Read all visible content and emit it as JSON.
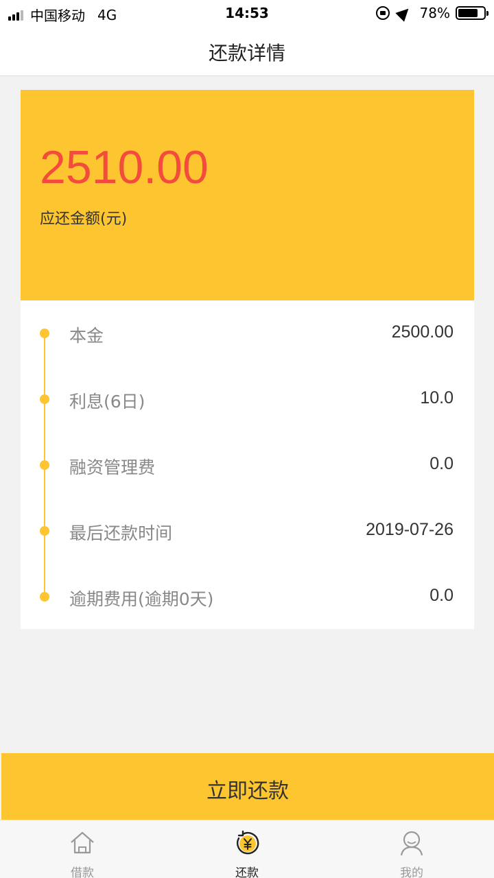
{
  "status_bar": {
    "carrier": "中国移动",
    "network": "4G",
    "time": "14:53",
    "battery": "78%"
  },
  "header": {
    "title": "还款详情"
  },
  "amount_card": {
    "amount": "2510.00",
    "label": "应还金额(元)"
  },
  "details": {
    "rows": [
      {
        "label": "本金",
        "value": "2500.00"
      },
      {
        "label": "利息(6日)",
        "value": "10.0"
      },
      {
        "label": "融资管理费",
        "value": "0.0"
      },
      {
        "label": "最后还款时间",
        "value": "2019-07-26"
      },
      {
        "label": "逾期费用(逾期0天)",
        "value": "0.0"
      }
    ]
  },
  "repay_button": {
    "label": "立即还款"
  },
  "tab_bar": {
    "tabs": [
      {
        "label": "借款",
        "icon": "home-icon"
      },
      {
        "label": "还款",
        "icon": "repay-yen-icon"
      },
      {
        "label": "我的",
        "icon": "user-icon"
      }
    ],
    "active": "还款"
  },
  "colors": {
    "accent": "#fdc52f",
    "amount": "#f34b3c"
  }
}
